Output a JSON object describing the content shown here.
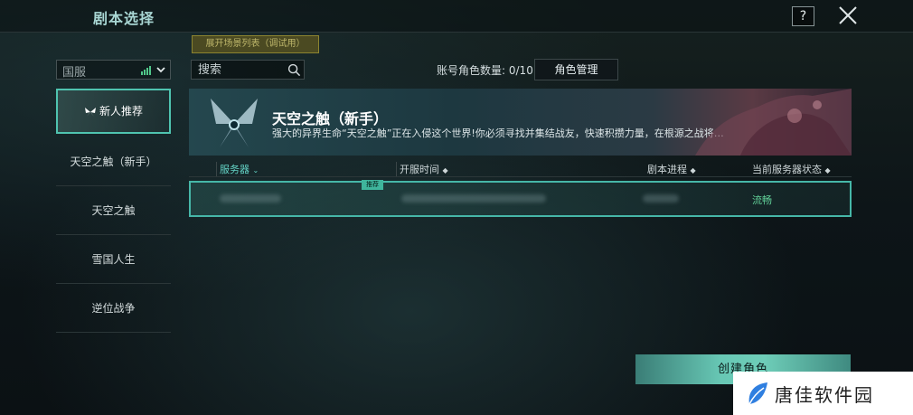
{
  "header": {
    "title": "剧本选择",
    "help_label": "?"
  },
  "debug_button_label": "展开场景列表（调试用）",
  "region_select": {
    "value": "国服"
  },
  "search": {
    "placeholder": "搜索"
  },
  "account": {
    "count_label": "账号角色数量:",
    "count_value": "0/10",
    "role_manage_label": "角色管理"
  },
  "sidebar": {
    "items": [
      {
        "label": "新人推荐",
        "active": true
      },
      {
        "label": "天空之触（新手）"
      },
      {
        "label": "天空之触"
      },
      {
        "label": "雪国人生"
      },
      {
        "label": "逆位战争"
      }
    ]
  },
  "banner": {
    "title": "天空之触（新手）",
    "description": "强大的异界生命“天空之触”正在入侵这个世界!你必须寻找并集结战友，快速积攒力量，在根源之战将…"
  },
  "table": {
    "columns": [
      {
        "label": "服务器",
        "sort": "⌄"
      },
      {
        "label": "开服时间",
        "sort": "◆"
      },
      {
        "label": "剧本进程",
        "sort": "◆"
      },
      {
        "label": "当前服务器状态",
        "sort": "◆"
      }
    ],
    "rows": [
      {
        "badge": "推荐",
        "status": "流畅"
      }
    ]
  },
  "create_button_label": "创建角色",
  "watermark_text": "唐佳软件园",
  "colors": {
    "accent": "#4fc4b0",
    "status_ok": "#62d29a",
    "debug_button": "#4b4a22"
  }
}
